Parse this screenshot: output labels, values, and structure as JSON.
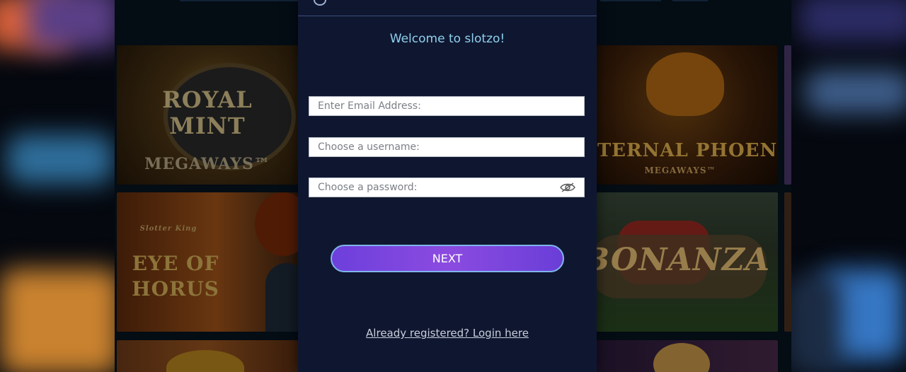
{
  "modal": {
    "welcome": "Welcome to slotzo!",
    "email_placeholder": "Enter Email Address:",
    "username_placeholder": "Choose a username:",
    "password_placeholder": "Choose a password:",
    "next_label": "NEXT",
    "login_link": "Already registered? Login here"
  },
  "games": {
    "royal_mint": {
      "line1": "ROYAL",
      "line2": "MINT",
      "line3": "MEGAWAYS™"
    },
    "eye_of_horus": {
      "brand": "Slotter King",
      "line1": "EYE OF",
      "line2": "HORUS"
    },
    "eternal_phoenix": {
      "line1": "ETERNAL PHOENIX",
      "line2": "MEGAWAYS™"
    },
    "bonanza": {
      "line1": "BONANZA"
    }
  },
  "colors": {
    "modal_bg": "#0f1730",
    "welcome_text": "#8fd0ee",
    "button_gradient_start": "#6d3fdc",
    "button_border": "#7fb5ea"
  },
  "icons": {
    "password_toggle": "eye-slash-icon"
  }
}
